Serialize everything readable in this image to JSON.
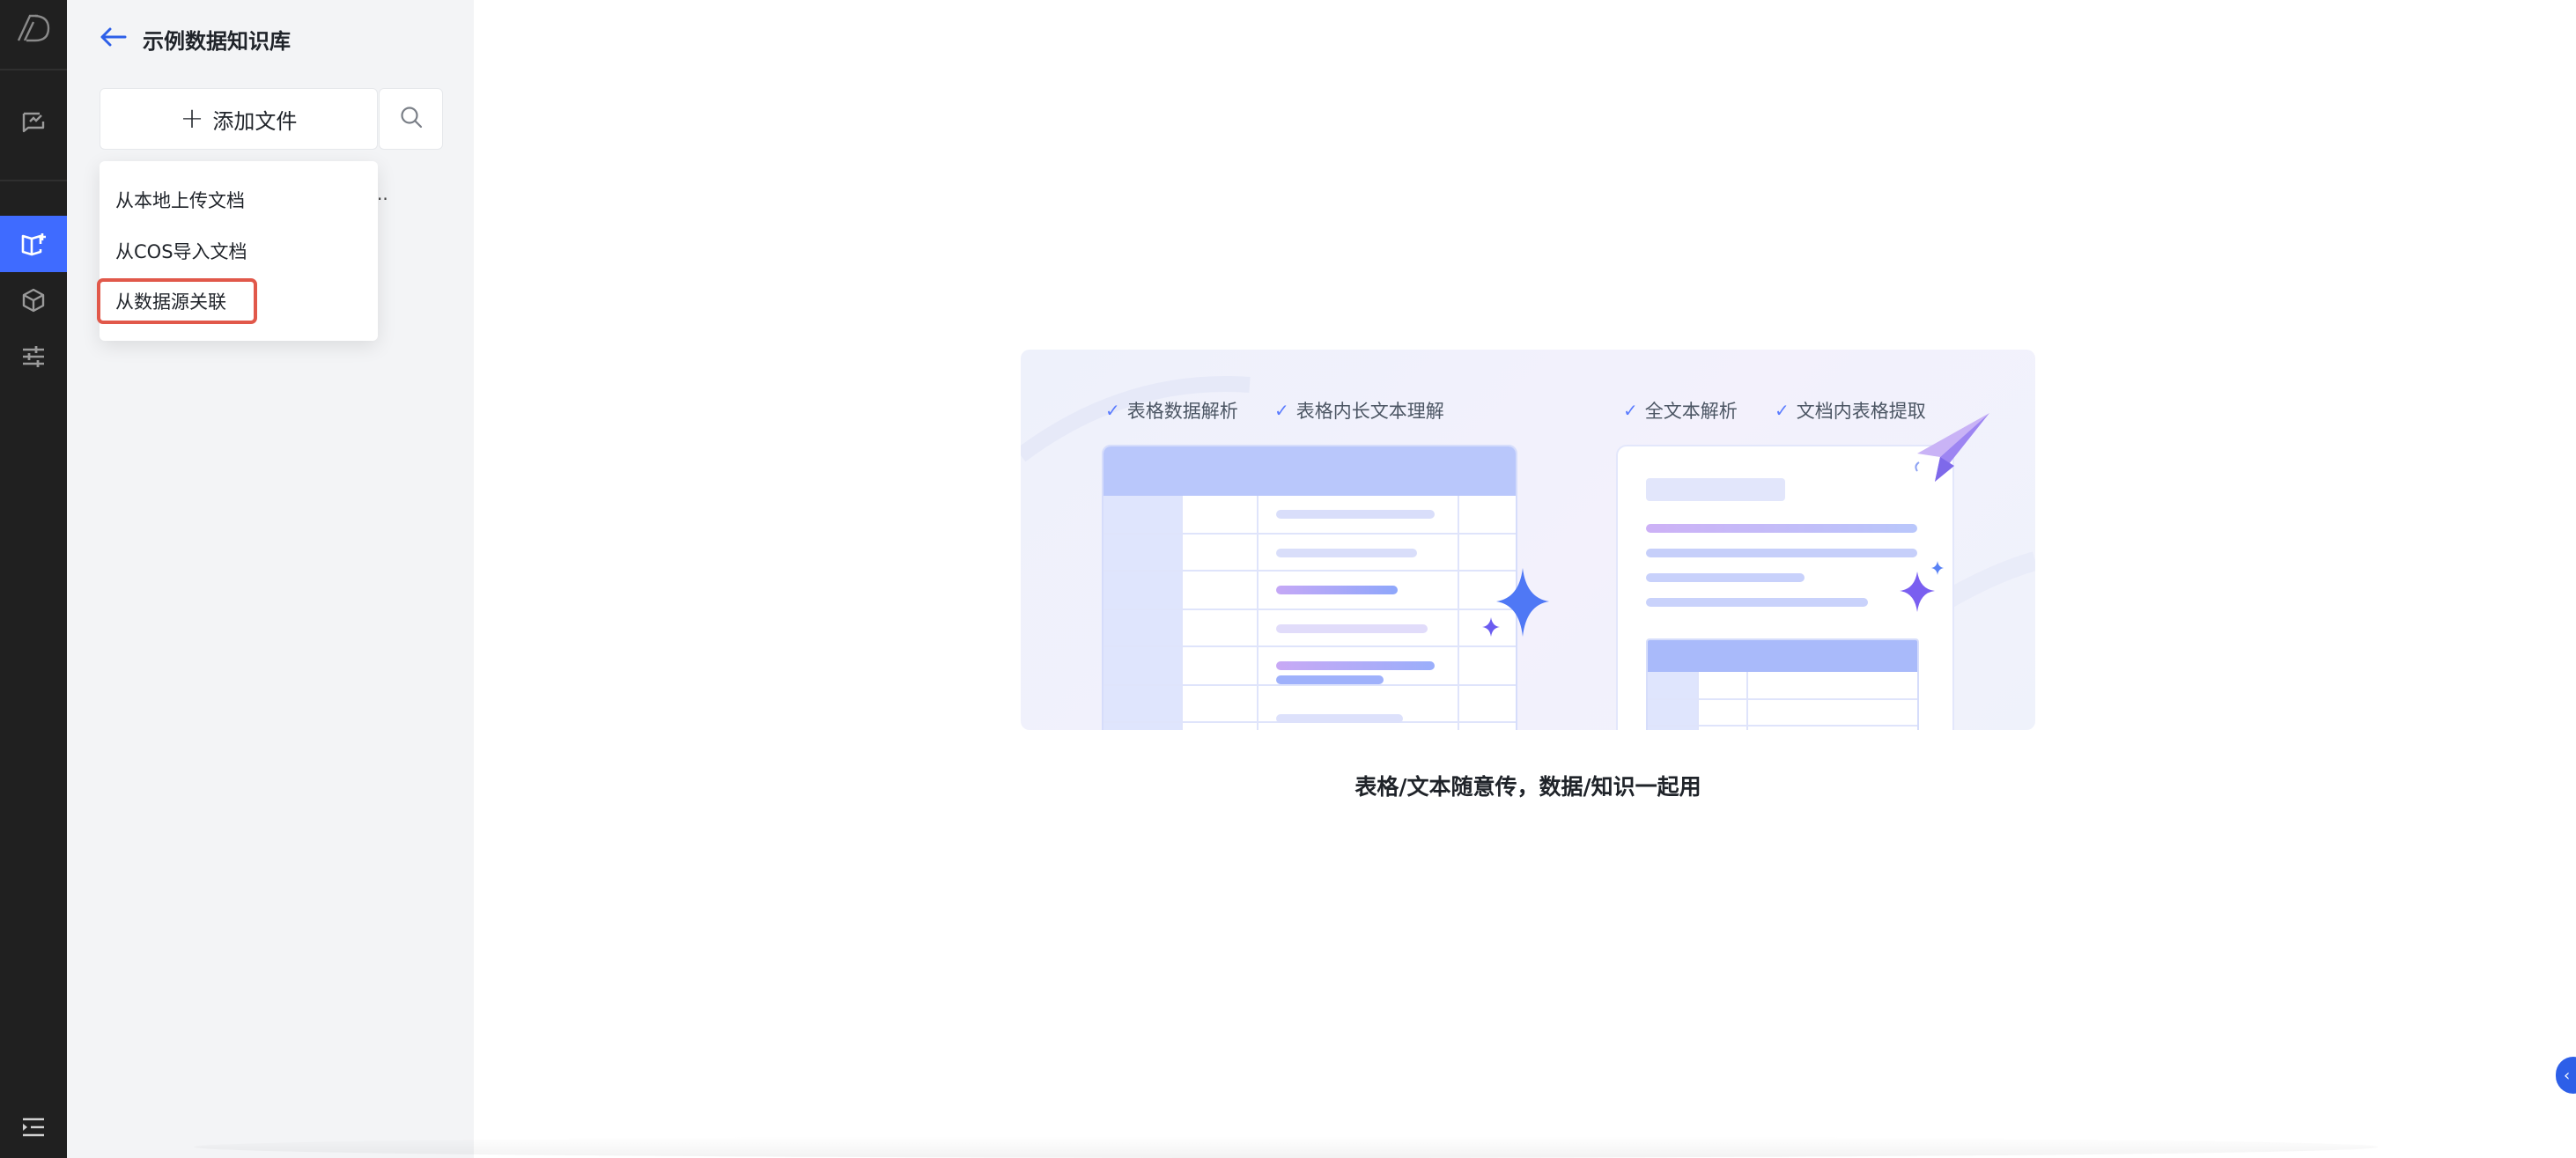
{
  "rail": {
    "items": [
      {
        "icon": "logo-icon"
      },
      {
        "icon": "chat-icon"
      },
      {
        "icon": "knowledge-base-icon",
        "active": true
      },
      {
        "icon": "cube-icon"
      },
      {
        "icon": "sliders-icon"
      },
      {
        "icon": "menu-collapse-icon"
      }
    ],
    "active_color": "#3f6bff",
    "background": "#202020"
  },
  "panel": {
    "title": "示例数据知识库",
    "add_file_label": "添加文件",
    "dropdown": {
      "items": [
        "从本地上传文档",
        "从COS导入文档",
        "从数据源关联"
      ],
      "highlighted_index": 2,
      "highlight_color": "#e1584a"
    },
    "truncated_text": ".."
  },
  "main": {
    "features_left": [
      "表格数据解析",
      "表格内长文本理解"
    ],
    "features_right": [
      "全文本解析",
      "文档内表格提取"
    ],
    "caption": "表格/文本随意传，数据/知识一起用"
  }
}
